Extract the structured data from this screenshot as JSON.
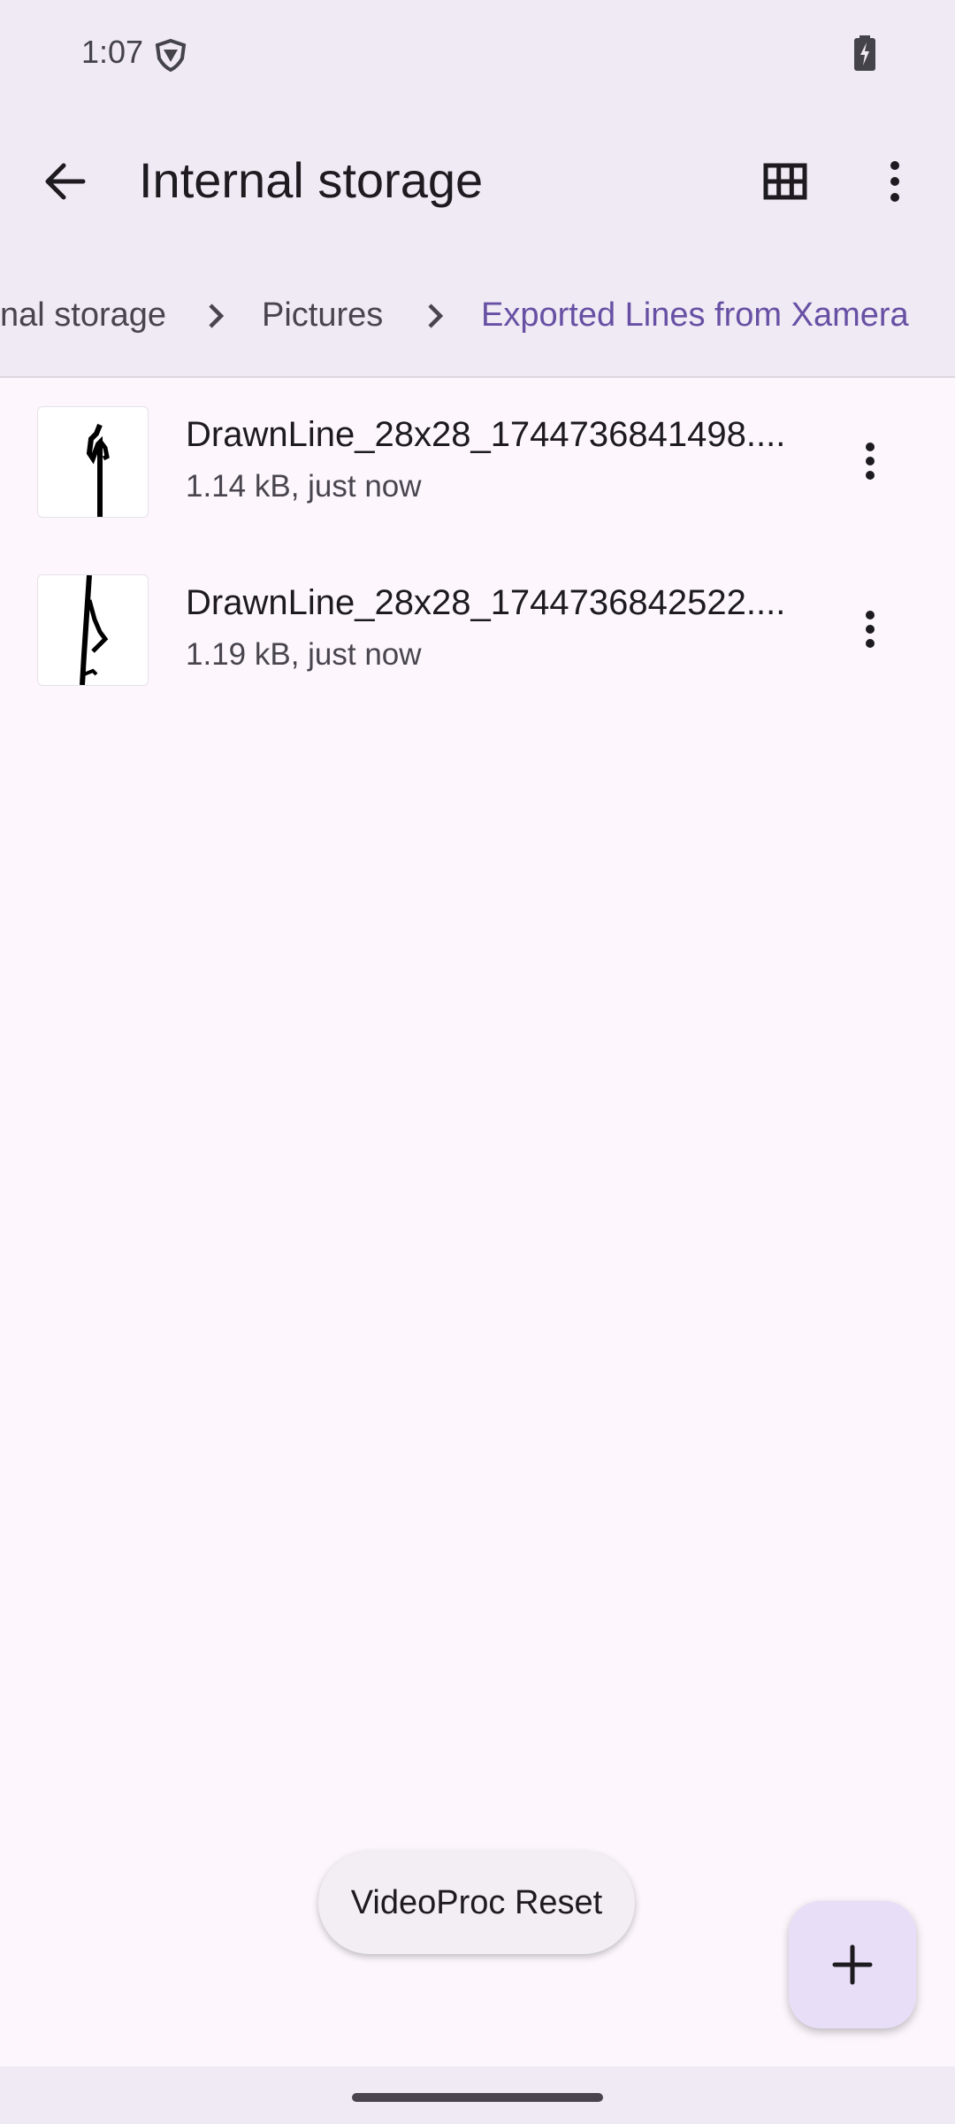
{
  "status_bar": {
    "time": "1:07",
    "icons": [
      "vpn-shield-icon",
      "battery-charging-icon"
    ]
  },
  "app_bar": {
    "title": "Internal storage",
    "icons": [
      "back-arrow-icon",
      "grid-view-icon",
      "more-vert-icon"
    ]
  },
  "breadcrumb": {
    "items": [
      {
        "label": "Internal storage",
        "visible_label": "nal storage"
      },
      {
        "label": "Pictures"
      },
      {
        "label": "Exported Lines from Xamera"
      }
    ]
  },
  "files": [
    {
      "name": "DrawnLine_28x28_1744736841498....",
      "meta": "1.14 kB, just now"
    },
    {
      "name": "DrawnLine_28x28_1744736842522....",
      "meta": "1.19 kB, just now"
    }
  ],
  "toast": {
    "text": "VideoProc Reset"
  },
  "fab": {
    "icon": "plus-icon"
  },
  "colors": {
    "accent": "#6750a4",
    "surface": "#fdf7fd",
    "bar": "#f0eaf4",
    "fab": "#e8def8"
  }
}
